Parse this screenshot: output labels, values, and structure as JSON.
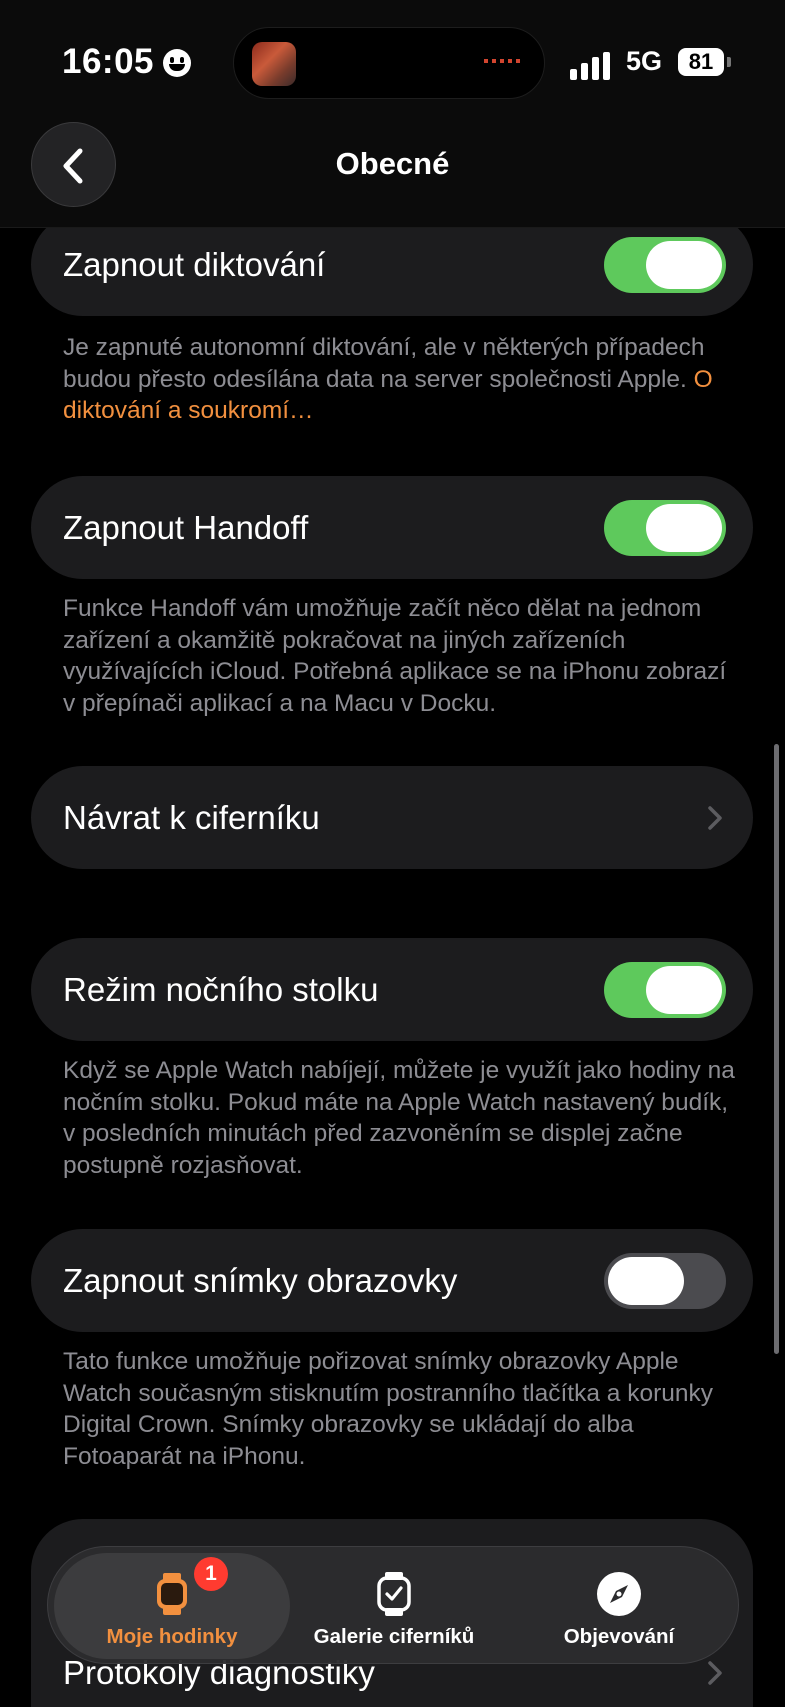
{
  "status_bar": {
    "time": "16:05",
    "network": "5G",
    "battery": "81"
  },
  "nav": {
    "title": "Obecné"
  },
  "settings": {
    "dictation": {
      "label": "Zapnout diktování",
      "enabled": true,
      "footnote": "Je zapnuté autonomní diktování, ale v některých případech budou přesto odesílána data na server společnosti Apple.",
      "footnote_link": "O diktování a soukromí…"
    },
    "handoff": {
      "label": "Zapnout Handoff",
      "enabled": true,
      "footnote": "Funkce Handoff vám umožňuje začít něco dělat na jednom zařízení a okamžitě pokračovat na jiných zařízeních využívajících iCloud. Potřebná aplikace se na iPhonu zobrazí v přepínači aplikací a na Macu v Docku."
    },
    "return_to_clock": {
      "label": "Návrat k ciferníku"
    },
    "nightstand": {
      "label": "Režim nočního stolku",
      "enabled": true,
      "footnote": "Když se Apple Watch nabíjejí, můžete je využít jako hodiny na nočním stolku. Pokud máte na Apple Watch nastavený budík, v posledních minutách před zazvoněním se displej začne postupně rozjasňovat."
    },
    "screenshots": {
      "label": "Zapnout snímky obrazovky",
      "enabled": false,
      "footnote": "Tato funkce umožňuje pořizovat snímky obrazovky Apple Watch současným stisknutím postranního tlačítka a korunky Digital Crown. Snímky obrazovky se ukládají do alba Fotoaparát na iPhonu."
    },
    "diagnostics": {
      "label": "Protokoly diagnostiky"
    }
  },
  "tab_bar": {
    "items": [
      {
        "label": "Moje hodinky",
        "icon": "watch-icon",
        "badge": "1",
        "selected": true,
        "color": "#f2903f"
      },
      {
        "label": "Galerie ciferníků",
        "icon": "watch-face-gallery-icon",
        "selected": false,
        "color": "#ffffff"
      },
      {
        "label": "Objevování",
        "icon": "compass-icon",
        "selected": false,
        "color": "#ffffff"
      }
    ]
  },
  "colors": {
    "accent": "#f2903f",
    "toggle_on": "#5ec95c",
    "background": "#000000",
    "card": "#1c1c1e"
  }
}
